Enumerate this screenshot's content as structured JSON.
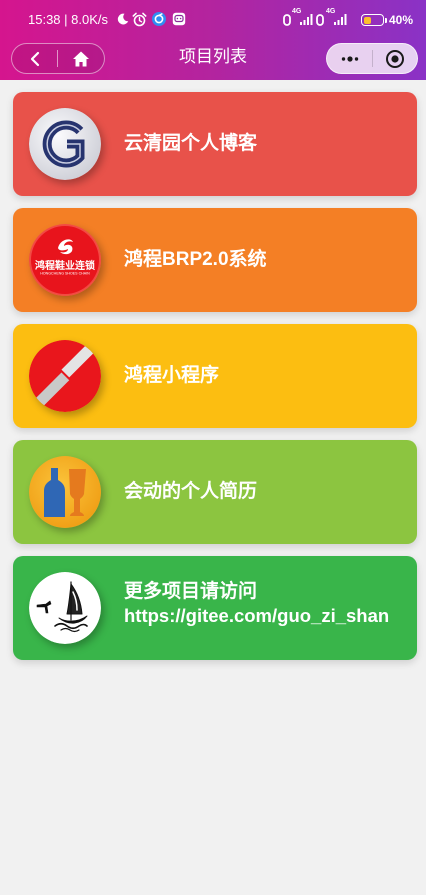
{
  "status_bar": {
    "time_speed": "15:38 | 8.0K/s",
    "network_type": "4G",
    "battery": "40%",
    "icons": [
      "moon-icon",
      "alarm-clock-icon",
      "app-notification-icon",
      "app-notification-icon",
      "hd-icon",
      "signal-icon",
      "hd-icon",
      "signal-icon",
      "battery-icon"
    ]
  },
  "nav": {
    "title": "项目列表",
    "icons": [
      "chevron-left-icon",
      "home-icon",
      "more-dots-icon",
      "target-circle-icon"
    ]
  },
  "theme": {
    "header_gradient": [
      "#d5158e",
      "#b3249f",
      "#8a32c6"
    ],
    "page_background": "#f1f1f1",
    "battery_fill": "#fbc02d"
  },
  "projects": [
    {
      "title": "云清园个人博客",
      "color": "#e8524a",
      "icon": "cnblogs-logo-icon"
    },
    {
      "title": "鸿程BRP2.0系统",
      "color": "#f47f25",
      "icon": "hongcheng-shoes-logo-icon",
      "logo_text": "鸿程鞋业连锁",
      "logo_subtext": "HONGCHENG SHOES CHAIN"
    },
    {
      "title": "鸿程小程序",
      "color": "#fcbe11",
      "icon": "hongcheng-miniprogram-logo-icon"
    },
    {
      "title": "会动的个人简历",
      "color": "#8cc540",
      "icon": "bottle-and-glass-icon"
    },
    {
      "title": "更多项目请访问",
      "subtitle": "https://gitee.com/guo_zi_shan",
      "color": "#39b54a",
      "icon": "ink-sailboat-icon"
    }
  ]
}
